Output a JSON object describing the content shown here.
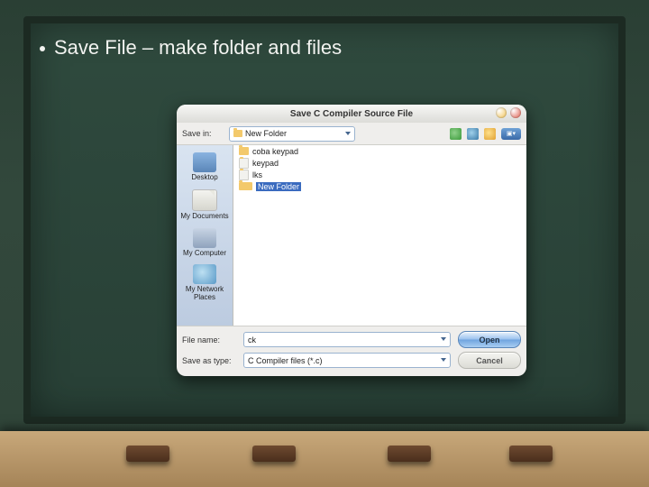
{
  "slide": {
    "bullet": "Save File – make folder and files"
  },
  "dialog": {
    "title": "Save C Compiler Source File",
    "savein_label": "Save in:",
    "savein_value": "New Folder",
    "view_btn": "▣▾",
    "places": {
      "desktop": "Desktop",
      "docs": "My Documents",
      "computer": "My Computer",
      "network": "My Network Places"
    },
    "items": [
      {
        "name": "coba keypad",
        "kind": "folder"
      },
      {
        "name": "keypad",
        "kind": "file"
      },
      {
        "name": "lks",
        "kind": "file"
      },
      {
        "name": "New Folder",
        "kind": "folder",
        "selected": true
      }
    ],
    "filename_label": "File name:",
    "filename_value": "ck",
    "type_label": "Save as type:",
    "type_value": "C Compiler files (*.c)",
    "btn_open": "Open",
    "btn_cancel": "Cancel"
  }
}
